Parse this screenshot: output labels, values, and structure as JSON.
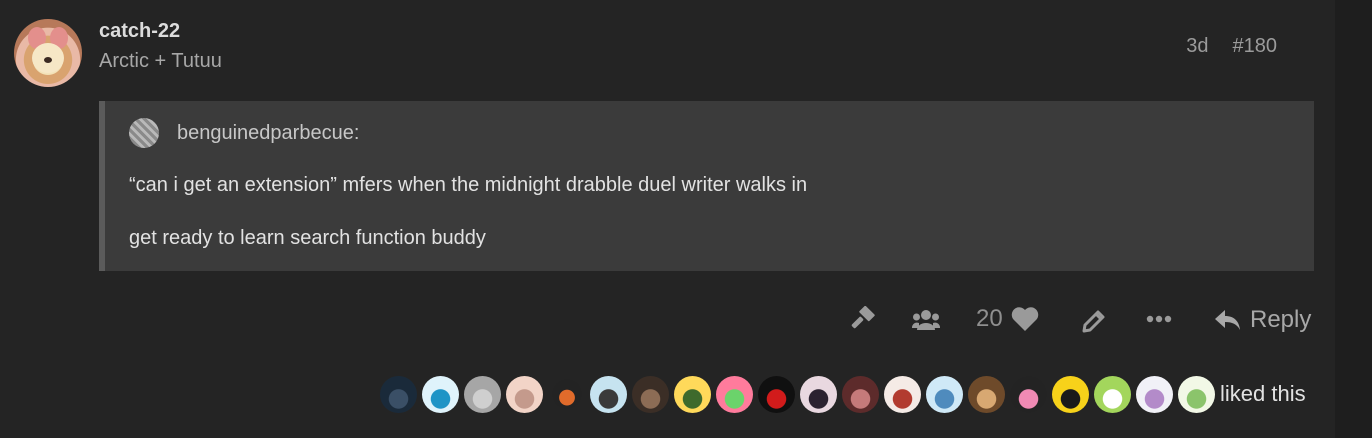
{
  "post": {
    "username": "catch-22",
    "user_title": "Arctic + Tutuu",
    "age": "3d",
    "post_number": "#180",
    "quote": {
      "author": "benguinedparbecue:",
      "lines": [
        "“can i get an extension” mfers when the midnight drabble duel writer walks in",
        "get ready to learn search function buddy"
      ]
    },
    "actions": {
      "like_count": "20",
      "reply_label": "Reply"
    },
    "likers": {
      "label": "liked this",
      "avatars": [
        {
          "colors": [
            "#1a2a3a",
            "#3a4f66"
          ]
        },
        {
          "colors": [
            "#dff3fb",
            "#1e94c6"
          ]
        },
        {
          "colors": [
            "#a6a6a6",
            "#cfcfcf"
          ]
        },
        {
          "colors": [
            "#f2d4c7",
            "#c49a8c"
          ]
        },
        {
          "colors": [
            "#232323",
            "#e06b2b"
          ]
        },
        {
          "colors": [
            "#c6e3f0",
            "#3a3a3a"
          ]
        },
        {
          "colors": [
            "#3b2e26",
            "#8c6c55"
          ]
        },
        {
          "colors": [
            "#ffd95a",
            "#3e6a2c"
          ]
        },
        {
          "colors": [
            "#ff7b9c",
            "#6bd36b"
          ]
        },
        {
          "colors": [
            "#101010",
            "#d21b1b"
          ]
        },
        {
          "colors": [
            "#e9d8e0",
            "#2b2230"
          ]
        },
        {
          "colors": [
            "#5d2b2b",
            "#c57a7a"
          ]
        },
        {
          "colors": [
            "#f5ebe6",
            "#b23b2f"
          ]
        },
        {
          "colors": [
            "#cfe9f7",
            "#4f8bbd"
          ]
        },
        {
          "colors": [
            "#6e4a2a",
            "#d8a872"
          ]
        },
        {
          "colors": [
            "#232323",
            "#f08ab4"
          ]
        },
        {
          "colors": [
            "#f7d21a",
            "#1a1a1a"
          ]
        },
        {
          "colors": [
            "#a3d65c",
            "#ffffff"
          ]
        },
        {
          "colors": [
            "#f1f1f7",
            "#b38bc9"
          ]
        },
        {
          "colors": [
            "#f2f8e6",
            "#8bc46b"
          ]
        }
      ]
    }
  },
  "colors": {
    "background": "#242424",
    "quote_background": "#3b3b3b",
    "quote_border": "#5b5b5b",
    "muted_text": "#9b9b9b"
  }
}
